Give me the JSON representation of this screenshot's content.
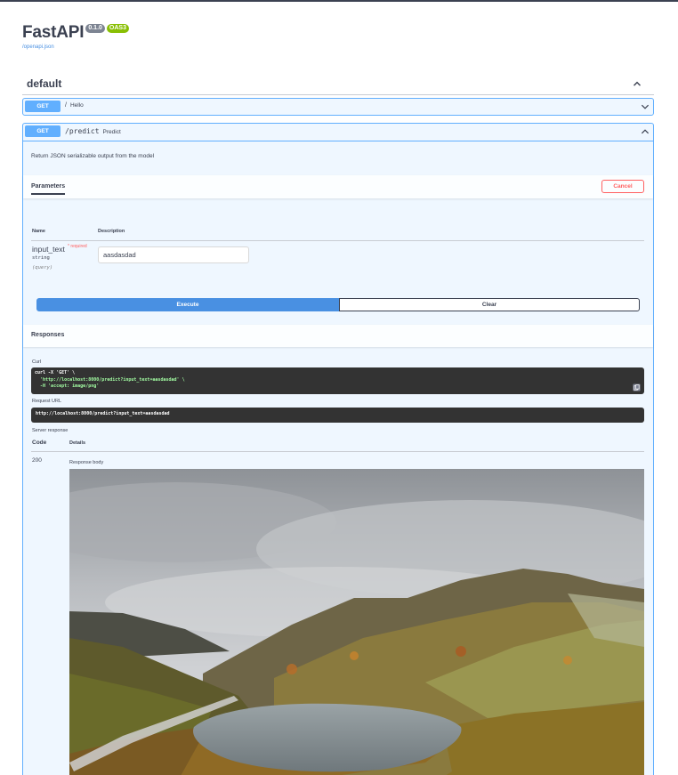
{
  "header": {
    "title": "FastAPI",
    "version": "0.1.0",
    "oas": "OAS3",
    "spec_link": "/openapi.json"
  },
  "tag": {
    "name": "default"
  },
  "operations": [
    {
      "method": "GET",
      "path": "/",
      "description": "Hello"
    },
    {
      "method": "GET",
      "path": "/predict",
      "description": "Predict"
    }
  ],
  "predict": {
    "summary": "Return JSON serializable output from the model",
    "parameters_tab": "Parameters",
    "cancel_label": "Cancel",
    "param_columns": {
      "name": "Name",
      "description": "Description"
    },
    "param": {
      "name": "input_text",
      "required": "* required",
      "type": "string",
      "in": "(query)",
      "value": "aasdasdad"
    },
    "execute_label": "Execute",
    "clear_label": "Clear",
    "responses_title": "Responses",
    "curl_label": "Curl",
    "curl_lines": [
      "curl -X 'GET' \\",
      "  'http://localhost:8000/predict?input_text=aasdasdad' \\",
      "  -H 'accept: image/png'"
    ],
    "request_url_label": "Request URL",
    "request_url": "http://localhost:8000/predict?input_text=aasdasdad",
    "server_response_label": "Server response",
    "code_column": "Code",
    "details_column": "Details",
    "response_code": "200",
    "response_body_label": "Response body"
  },
  "colors": {
    "get": "#61affe",
    "execute": "#4990e2",
    "cancel": "#ff6060",
    "oas_badge": "#89bf04",
    "version_badge": "#7d8492"
  },
  "icons": [
    "chevron-up-icon",
    "chevron-down-icon",
    "copy-icon"
  ]
}
